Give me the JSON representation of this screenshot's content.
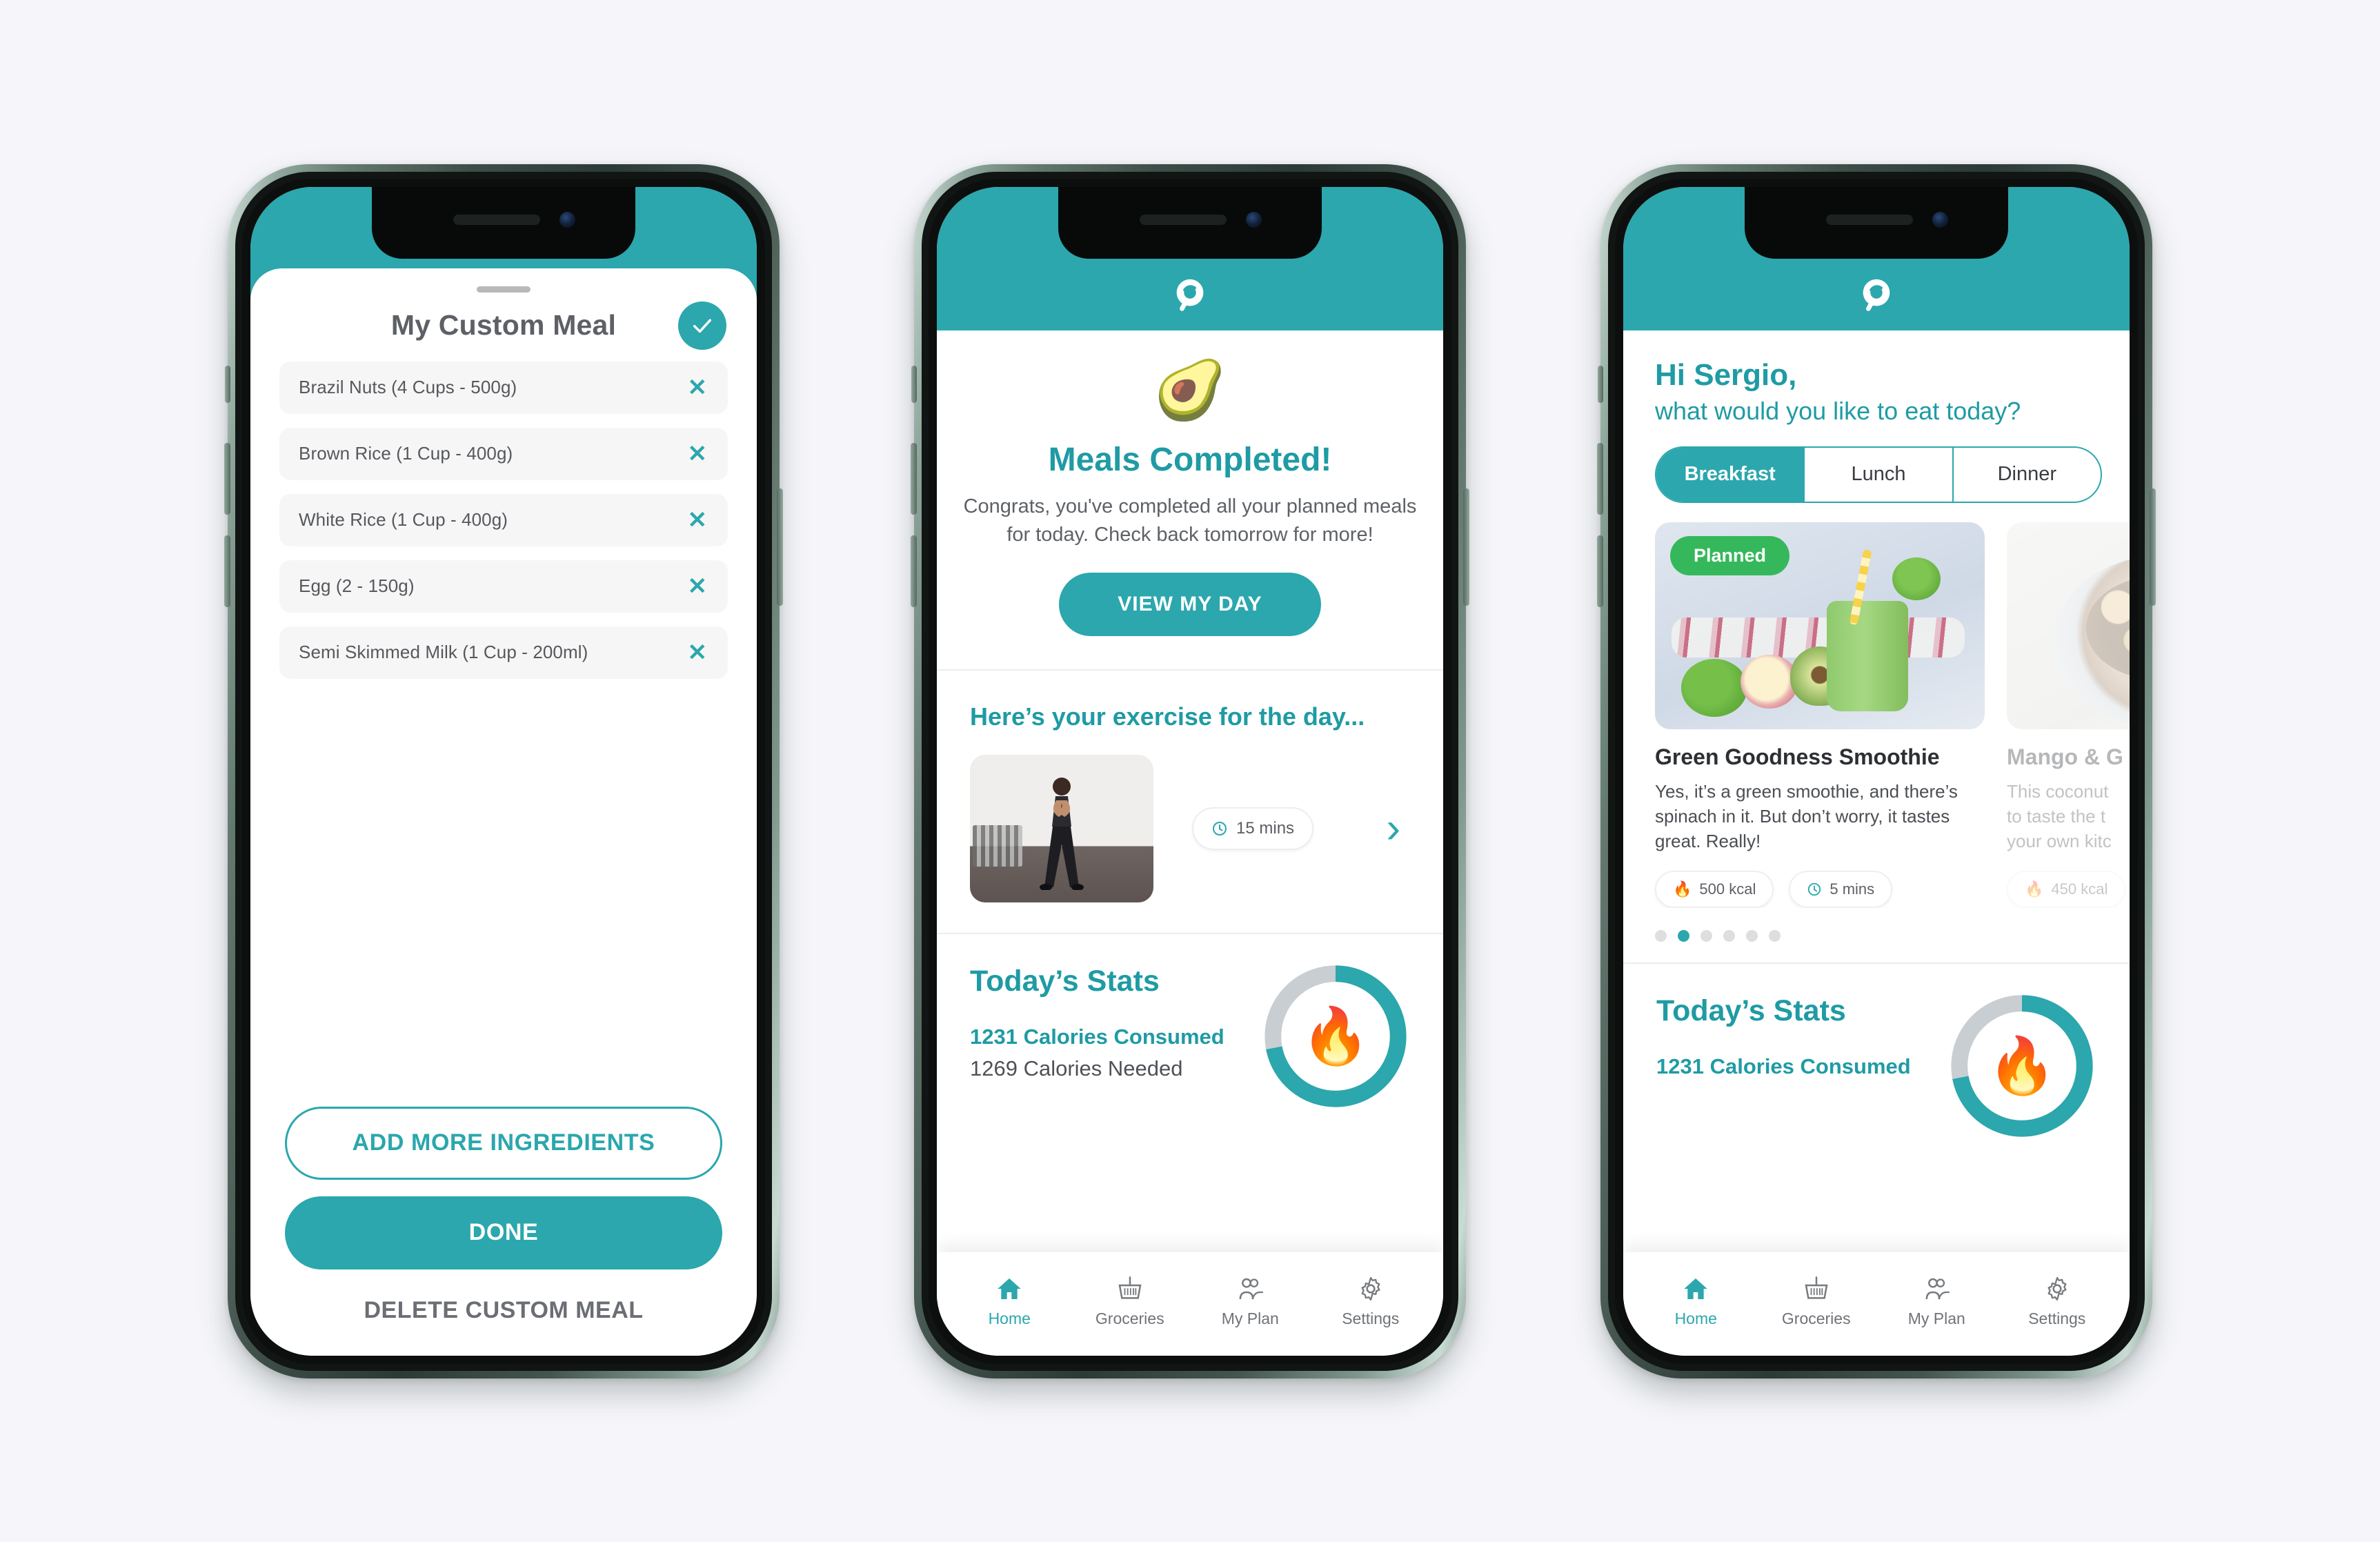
{
  "brand": {
    "accent": "#2BA7AD",
    "accent_dark": "#1F9BA4",
    "green": "#35B85B",
    "logo_name": "app-logo-p"
  },
  "phone1": {
    "sheet_title": "My Custom Meal",
    "confirm_icon": "check-icon",
    "ingredients": [
      {
        "label": "Brazil Nuts (4 Cups - 500g)",
        "remove_icon": "close-icon"
      },
      {
        "label": "Brown Rice (1 Cup - 400g)",
        "remove_icon": "close-icon"
      },
      {
        "label": "White Rice (1 Cup - 400g)",
        "remove_icon": "close-icon"
      },
      {
        "label": "Egg (2 - 150g)",
        "remove_icon": "close-icon"
      },
      {
        "label": "Semi Skimmed Milk (1 Cup - 200ml)",
        "remove_icon": "close-icon"
      }
    ],
    "add_more_label": "ADD MORE INGREDIENTS",
    "done_label": "DONE",
    "delete_label": "DELETE CUSTOM MEAL"
  },
  "phone2": {
    "hero_emoji": "🥑",
    "hero_emoji_name": "avocado-icon",
    "title": "Meals Completed!",
    "subtitle": "Congrats, you've completed all your planned meals for today. Check back tomorrow for more!",
    "cta_label": "VIEW MY DAY",
    "exercise_title": "Here’s your exercise for the day...",
    "exercise_duration": "15 mins",
    "exercise_clock_icon": "clock-icon",
    "exercise_chevron": "chevron-right-icon",
    "stats_title": "Today’s Stats",
    "calories_consumed": "1231 Calories Consumed",
    "calories_needed": "1269 Calories Needed",
    "ring_percent": 72,
    "flame_emoji": "🔥",
    "flame_icon_name": "flame-icon"
  },
  "phone3": {
    "greeting_line1": "Hi Sergio,",
    "greeting_line2": "what would you like to eat today?",
    "meal_tabs": [
      {
        "label": "Breakfast",
        "active": true
      },
      {
        "label": "Lunch",
        "active": false
      },
      {
        "label": "Dinner",
        "active": false
      }
    ],
    "cards": [
      {
        "badge": "Planned",
        "title": "Green Goodness Smoothie",
        "description": "Yes, it’s a green smoothie, and there’s spinach in it. But don’t worry, it tastes great. Really!",
        "kcal": "500 kcal",
        "time": "5 mins",
        "kcal_icon": "flame-icon",
        "time_icon": "clock-icon"
      },
      {
        "badge": "",
        "title": "Mango & G",
        "description": "This coconut\nto taste the t\nyour own kitc",
        "kcal": "450 kcal",
        "time": "",
        "kcal_icon": "flame-icon",
        "time_icon": ""
      }
    ],
    "pagination": {
      "count": 6,
      "active_index": 1
    },
    "stats_title": "Today’s Stats",
    "calories_consumed": "1231 Calories Consumed",
    "ring_percent": 72,
    "flame_emoji": "🔥"
  },
  "nav": [
    {
      "label": "Home",
      "icon": "home-icon",
      "active": true
    },
    {
      "label": "Groceries",
      "icon": "basket-icon",
      "active": false
    },
    {
      "label": "My Plan",
      "icon": "people-icon",
      "active": false
    },
    {
      "label": "Settings",
      "icon": "gear-icon",
      "active": false
    }
  ]
}
